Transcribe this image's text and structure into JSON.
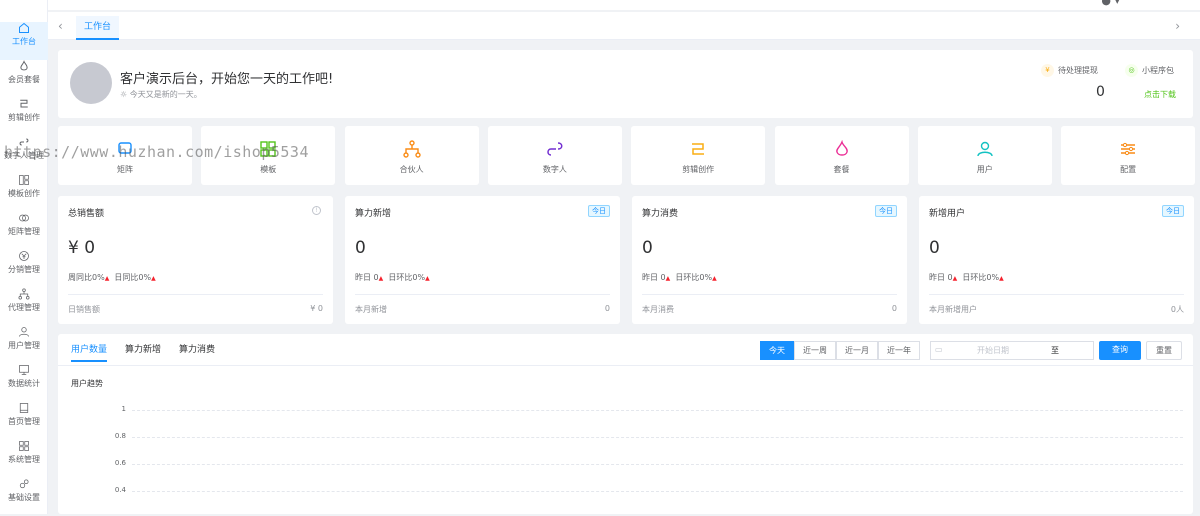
{
  "sidebar": {
    "items": [
      {
        "label": "工作台",
        "icon": "home-icon",
        "active": true
      },
      {
        "label": "会员套餐",
        "icon": "flame-icon"
      },
      {
        "label": "剪辑创作",
        "icon": "flow-icon"
      },
      {
        "label": "数字人管理",
        "icon": "link-icon"
      },
      {
        "label": "模板创作",
        "icon": "template-icon"
      },
      {
        "label": "矩阵管理",
        "icon": "matrix-icon"
      },
      {
        "label": "分销管理",
        "icon": "yen-icon"
      },
      {
        "label": "代理管理",
        "icon": "org-icon"
      },
      {
        "label": "用户管理",
        "icon": "user-icon"
      },
      {
        "label": "数据统计",
        "icon": "stats-icon"
      },
      {
        "label": "首页管理",
        "icon": "page-icon"
      },
      {
        "label": "系统管理",
        "icon": "grid-icon"
      },
      {
        "label": "基础设置",
        "icon": "gears-icon"
      }
    ]
  },
  "tabs": {
    "active_label": "工作台"
  },
  "welcome": {
    "greeting": "客户演示后台，开始您一天的工作吧!",
    "sub": "今天又是新的一天。",
    "pending_label": "待处理提现",
    "pending_value": "0",
    "miniapp_label": "小程序包",
    "miniapp_link": "点击下载"
  },
  "quick_links": [
    {
      "label": "矩阵",
      "icon": "matrix-link-icon"
    },
    {
      "label": "模板",
      "icon": "template-link-icon"
    },
    {
      "label": "合伙人",
      "icon": "partner-icon"
    },
    {
      "label": "数字人",
      "icon": "digital-human-icon"
    },
    {
      "label": "剪辑创作",
      "icon": "edit-flow-icon"
    },
    {
      "label": "套餐",
      "icon": "package-icon"
    },
    {
      "label": "用户",
      "icon": "user-link-icon"
    },
    {
      "label": "配置",
      "icon": "config-icon"
    }
  ],
  "metrics": [
    {
      "title": "总销售额",
      "badge": "",
      "value": "¥ 0",
      "cmp1": "周同比0%",
      "cmp2": "日同比0%",
      "foot_label": "日销售额",
      "foot_value": "¥ 0"
    },
    {
      "title": "算力新增",
      "badge": "今日",
      "value": "0",
      "cmp1": "昨日 0",
      "cmp2": "日环比0%",
      "foot_label": "本月新增",
      "foot_value": "0"
    },
    {
      "title": "算力消费",
      "badge": "今日",
      "value": "0",
      "cmp1": "昨日 0",
      "cmp2": "日环比0%",
      "foot_label": "本月消费",
      "foot_value": "0"
    },
    {
      "title": "新增用户",
      "badge": "今日",
      "value": "0",
      "cmp1": "昨日 0",
      "cmp2": "日环比0%",
      "foot_label": "本月新增用户",
      "foot_value": "0人"
    }
  ],
  "chart_panel": {
    "tabs": [
      "用户数量",
      "算力新增",
      "算力消费"
    ],
    "ranges": [
      "今天",
      "近一周",
      "近一月",
      "近一年"
    ],
    "date_start_placeholder": "开始日期",
    "date_sep": "至",
    "query_label": "查询",
    "reset_label": "重置"
  },
  "chart_data": {
    "type": "line",
    "title": "用户趋势",
    "y_ticks": [
      "1",
      "0.8",
      "0.6",
      "0.4"
    ],
    "series": []
  },
  "watermark": "https://www.huzhan.com/ishop5534",
  "colors": {
    "accent": "#1890ff",
    "up": "#f5222d",
    "link_green": "#52c41a"
  }
}
